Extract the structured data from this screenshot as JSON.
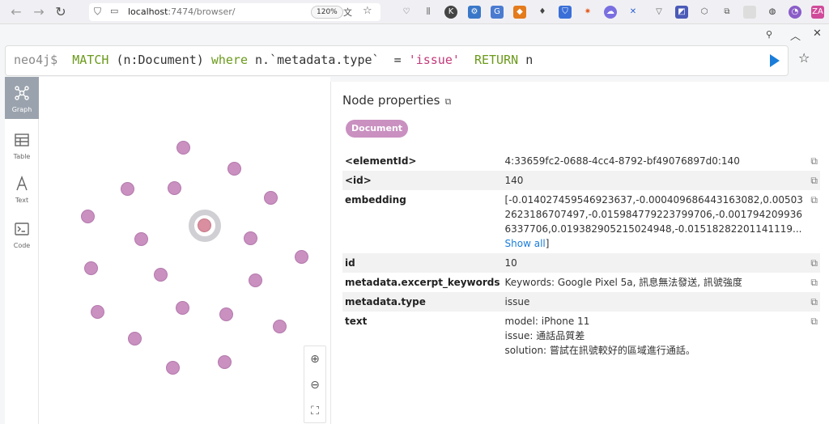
{
  "browser": {
    "url_host": "localhost",
    "url_rest": ":7474/browser/",
    "zoom": "120%"
  },
  "query": {
    "prompt": "neo4j$",
    "match": "MATCH",
    "pattern": "(n:Document)",
    "where": "where",
    "prop": "n.`metadata.type`",
    "eq": "=",
    "value": "'issue'",
    "return": "RETURN",
    "ret_var": "n"
  },
  "view_tabs": [
    {
      "label": "Graph",
      "icon": "graph-icon",
      "active": true
    },
    {
      "label": "Table",
      "icon": "table-icon",
      "active": false
    },
    {
      "label": "Text",
      "icon": "text-icon",
      "active": false
    },
    {
      "label": "Code",
      "icon": "code-icon",
      "active": false
    }
  ],
  "panel": {
    "title": "Node properties",
    "label": "Document",
    "show_all": "Show all",
    "properties": [
      {
        "key": "<elementId>",
        "value": "4:33659fc2-0688-4cc4-8792-bf49076897d0:140"
      },
      {
        "key": "<id>",
        "value": "140"
      },
      {
        "key": "embedding",
        "value": "[-0.014027459546923637,-0.000409686443163082,0.005032623186707497,-0.015984779223799706,-0.0017942099366337706,0.019382905215024948,-0.01518282201141119...",
        "suffix": "]"
      },
      {
        "key": "id",
        "value": "10"
      },
      {
        "key": "metadata.excerpt_keywords",
        "value": "Keywords: Google Pixel 5a, 訊息無法發送, 訊號強度"
      },
      {
        "key": "metadata.type",
        "value": "issue"
      },
      {
        "key": "text",
        "lines": [
          "model: iPhone 11",
          "issue: 通話品質差",
          "solution: 嘗試在訊號較好的區域進行通話。"
        ]
      }
    ]
  },
  "colors": {
    "node": "#c990c0",
    "keyword": "#6b9a1b",
    "string": "#c23a7a",
    "accent": "#1a7dd9"
  }
}
